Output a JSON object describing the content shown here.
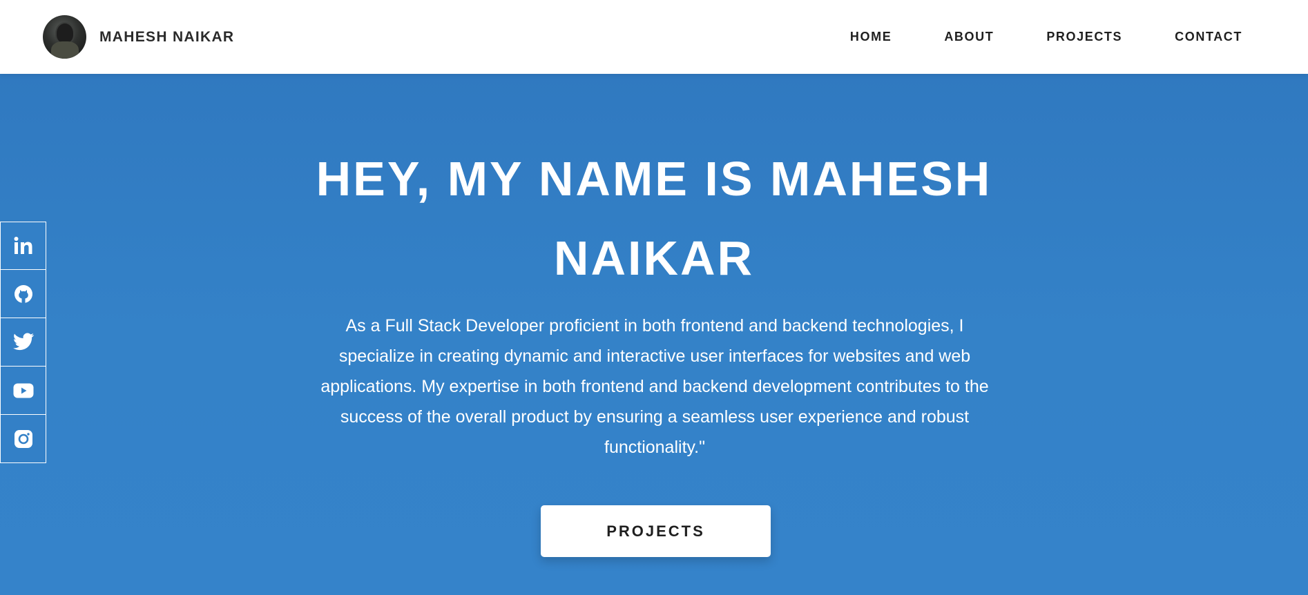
{
  "header": {
    "brand_name": "MAHESH NAIKAR",
    "nav": [
      "HOME",
      "ABOUT",
      "PROJECTS",
      "CONTACT"
    ]
  },
  "hero": {
    "title_line1": "HEY, MY NAME IS MAHESH",
    "title_line2": "NAIKAR",
    "description": "As a Full Stack Developer proficient in both frontend and backend technologies, I specialize in creating dynamic and interactive user interfaces for websites and web applications. My expertise in both frontend and backend development contributes to the success of the overall product by ensuring a seamless user experience and robust functionality.\"",
    "button_label": "PROJECTS"
  },
  "social": {
    "icons": [
      "linkedin-icon",
      "github-icon",
      "twitter-icon",
      "youtube-icon",
      "instagram-icon"
    ]
  },
  "colors": {
    "hero_background": "#3380c7",
    "header_background": "#ffffff",
    "text_dark": "#1f1f1f",
    "text_light": "#ffffff"
  }
}
